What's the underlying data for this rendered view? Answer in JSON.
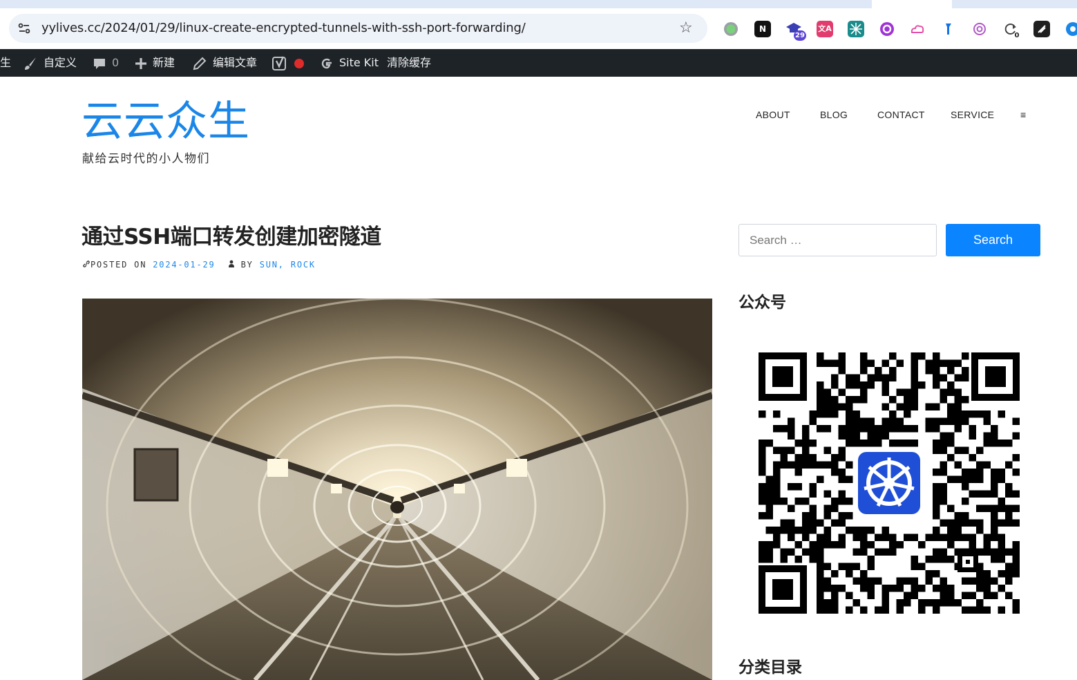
{
  "browser": {
    "url": "yylives.cc/2024/01/29/linux-create-encrypted-tunnels-with-ssh-port-forwarding/",
    "extensions": [
      {
        "icon": "green-dot-extension-icon",
        "label": "",
        "badge": ""
      },
      {
        "icon": "notion-icon",
        "label": "N",
        "badge": ""
      },
      {
        "icon": "graduation-cap-icon",
        "label": "",
        "badge": "29"
      },
      {
        "icon": "translate-icon",
        "label": "文A",
        "badge": ""
      },
      {
        "icon": "teal-grid-extension-icon",
        "label": "",
        "badge": ""
      },
      {
        "icon": "purple-dollar-extension-icon",
        "label": "",
        "badge": ""
      },
      {
        "icon": "pink-cloud-extension-icon",
        "label": "",
        "badge": ""
      },
      {
        "icon": "blue-flag-extension-icon",
        "label": "",
        "badge": ""
      },
      {
        "icon": "openai-icon",
        "label": "",
        "badge": ""
      },
      {
        "icon": "refresh-counter-icon",
        "label": "",
        "badge": "0"
      },
      {
        "icon": "dark-tag-extension-icon",
        "label": "",
        "badge": ""
      },
      {
        "icon": "blue-circle-extension-icon",
        "label": "",
        "badge": ""
      }
    ]
  },
  "adminbar": {
    "site_fragment": "生",
    "customize": "自定义",
    "comments_count": "0",
    "new": "新建",
    "edit_post": "编辑文章",
    "sitekit": "Site Kit",
    "clear_cache": "清除缓存"
  },
  "site": {
    "title": "云云众生",
    "description": "献给云时代的小人物们"
  },
  "nav": {
    "items": [
      "ABOUT",
      "BLOG",
      "CONTACT",
      "SERVICE"
    ],
    "more": "≡"
  },
  "post": {
    "title": "通过SSH端口转发创建加密隧道",
    "posted_on_label": "POSTED ON",
    "date": "2024-01-29",
    "by_label": "BY",
    "author_1": "SUN",
    "author_sep": ",",
    "author_2": "ROCK"
  },
  "sidebar": {
    "search_placeholder": "Search …",
    "search_button": "Search",
    "wechat_title": "公众号",
    "category_title": "分类目录"
  },
  "colors": {
    "accent": "#1a86e8",
    "search_button": "#0a84ff",
    "adminbar_bg": "#1d2327",
    "recording_dot": "#e02b2b"
  }
}
